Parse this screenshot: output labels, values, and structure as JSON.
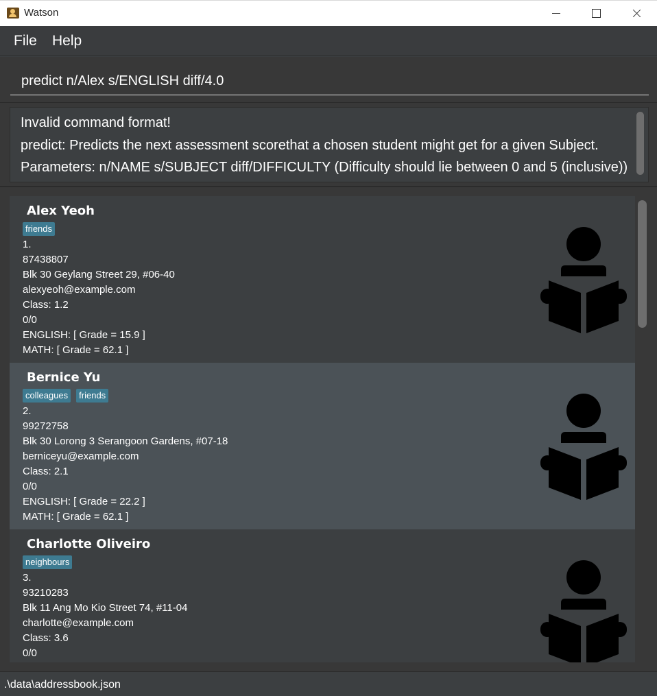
{
  "window": {
    "title": "Watson"
  },
  "menu": {
    "file": "File",
    "help": "Help"
  },
  "command": {
    "value": "predict n/Alex s/ENGLISH diff/4.0"
  },
  "result": {
    "lines": [
      "Invalid command format!",
      "predict: Predicts the next assessment scorethat a chosen student might get for a given Subject.",
      "Parameters: n/NAME s/SUBJECT diff/DIFFICULTY (Difficulty should lie between 0 and 5 (inclusive))"
    ]
  },
  "students": [
    {
      "name": "Alex Yeoh",
      "tags": [
        "friends"
      ],
      "index": "1.",
      "phone": "87438807",
      "address": "Blk 30 Geylang Street 29, #06-40",
      "email": "alexyeoh@example.com",
      "class": "Class: 1.2",
      "attendance": "0/0",
      "english": "ENGLISH: [ Grade = 15.9 ]",
      "math": "MATH: [ Grade = 62.1 ]"
    },
    {
      "name": "Bernice Yu",
      "tags": [
        "colleagues",
        "friends"
      ],
      "index": "2.",
      "phone": "99272758",
      "address": "Blk 30 Lorong 3 Serangoon Gardens, #07-18",
      "email": "berniceyu@example.com",
      "class": "Class: 2.1",
      "attendance": "0/0",
      "english": "ENGLISH: [ Grade = 22.2 ]",
      "math": "MATH: [ Grade = 62.1 ]"
    },
    {
      "name": "Charlotte Oliveiro",
      "tags": [
        "neighbours"
      ],
      "index": "3.",
      "phone": "93210283",
      "address": "Blk 11 Ang Mo Kio Street 74, #11-04",
      "email": "charlotte@example.com",
      "class": "Class: 3.6",
      "attendance": "0/0"
    }
  ],
  "icons": {
    "student": "reading-student-icon"
  },
  "status": {
    "file_path": ".\\data\\addressbook.json"
  },
  "colors": {
    "tag": "#3e7b91",
    "background": "#3c3f41",
    "selected_row": "#4b5257"
  }
}
